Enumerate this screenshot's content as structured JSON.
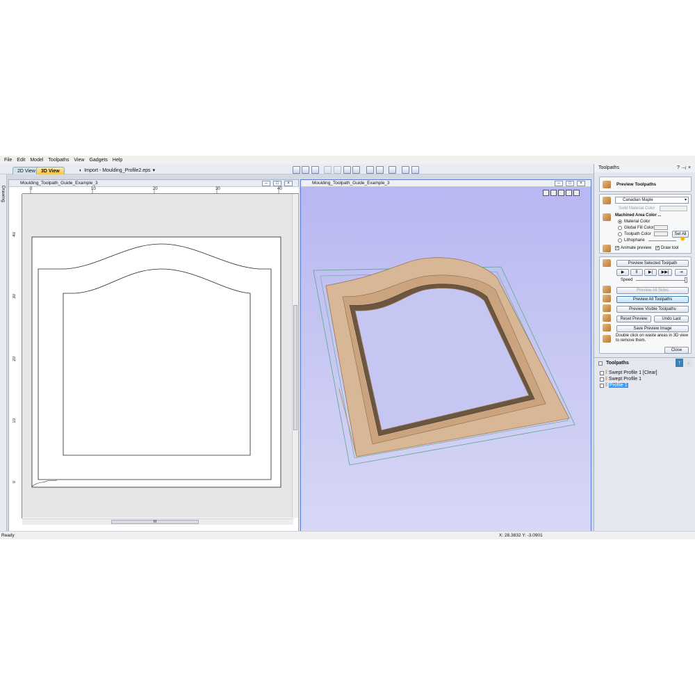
{
  "menu": [
    "File",
    "Edit",
    "Model",
    "Toolpaths",
    "View",
    "Gadgets",
    "Help"
  ],
  "tabs": {
    "view2d": "2D View",
    "view3d": "3D View"
  },
  "import_label": "Import - Moulding_Profile2.eps",
  "side_label": "Drawing",
  "pane2d": {
    "title": "Moulding_Toolpath_Guide_Example_3",
    "hticks": [
      "0",
      "10",
      "20",
      "30",
      "40"
    ],
    "vticks": [
      "40",
      "30",
      "20",
      "10",
      "0"
    ],
    "scroll_mark": "III"
  },
  "pane3d": {
    "title": "Moulding_Toolpath_Guide_Example_3"
  },
  "right_panel": {
    "title": "Toolpaths",
    "header": "Preview Toolpaths",
    "material": "Canadian Maple",
    "solid_material_color": "Solid Material Color",
    "machined_area": "Machined Area Color ...",
    "radios": [
      "Material Color",
      "Global Fill Color",
      "Toolpath Color",
      "Lithophane"
    ],
    "set_all": "Set All",
    "animate_preview": "Animate preview",
    "draw_tool": "Draw tool",
    "preview_selected": "Preview Selected Toolpath",
    "speed": "Speed",
    "preview_all_sides": "Preview All Sides",
    "preview_all_toolpaths": "Preview All Toolpaths",
    "preview_visible": "Preview Visible Toolpaths",
    "reset_preview": "Reset Preview",
    "undo_last": "Undo Last",
    "save_preview_image": "Save Preview Image",
    "hint": "Double click on waste areas in 3D view to remove them.",
    "close": "Close",
    "toolpaths_header": "Toolpaths",
    "toolpath_items": [
      "Swept Profile 1 [Clear]",
      "Swept Profile 1",
      "Profile 1"
    ]
  },
  "status": {
    "left": "Ready",
    "coords": "X: 28.3832 Y: -3.0901"
  },
  "colors": {
    "accent": "#3c7fb1",
    "bg3d": "#c6c6f3",
    "wood": "#d7b796"
  },
  "icons": [
    "help-icon",
    "pin-icon",
    "close-icon",
    "move-up-icon",
    "move-down-icon",
    "play-icon",
    "pause-icon",
    "step-icon",
    "fast-forward-icon",
    "skip-icon",
    "sun-icon"
  ]
}
